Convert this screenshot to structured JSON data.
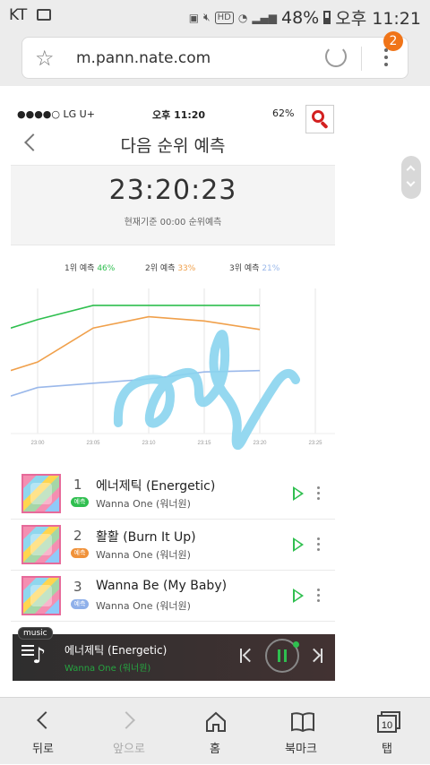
{
  "statusbar": {
    "carrier": "KT",
    "battery": "48%",
    "time": "오후 11:21",
    "hd": "HD"
  },
  "browser": {
    "url": "m.pann.nate.com",
    "tab_badge": "2"
  },
  "embedded": {
    "status": {
      "carrier": "●●●●○ LG U+",
      "time": "오후 11:20",
      "battery": "62%"
    },
    "title": "다음 순위 예측",
    "countdown": "23:20:23",
    "countdown_sub": "현재기준 00:00 순위예측",
    "legend": [
      {
        "label": "1위 예측",
        "pct": "46%",
        "color": "#2fbf4f"
      },
      {
        "label": "2위 예측",
        "pct": "33%",
        "color": "#f0a04b"
      },
      {
        "label": "3위 예측",
        "pct": "21%",
        "color": "#9ab8ea"
      }
    ],
    "chart_data": {
      "type": "line",
      "x": [
        "23:00",
        "23:05",
        "23:10",
        "23:15",
        "23:20",
        "23:25"
      ],
      "series": [
        {
          "values": [
            78,
            88,
            88,
            88,
            88,
            null
          ],
          "color": "#2fbf4f"
        },
        {
          "values": [
            48,
            72,
            80,
            77,
            71,
            null
          ],
          "color": "#f0a04b"
        },
        {
          "values": [
            30,
            33,
            36,
            41,
            42,
            null
          ],
          "color": "#9ab8ea"
        }
      ],
      "ylim": [
        0,
        100
      ],
      "grid": "vertical",
      "legend": "top"
    },
    "songs": [
      {
        "rank": "1",
        "title": "에너제틱 (Energetic)",
        "artist": "Wanna One (워너원)",
        "tag": "예측",
        "tag_color": "#2fbf4f"
      },
      {
        "rank": "2",
        "title": "활활 (Burn It Up)",
        "artist": "Wanna One (워너원)",
        "tag": "예측",
        "tag_color": "#f0923a"
      },
      {
        "rank": "3",
        "title": "Wanna Be (My Baby)",
        "artist": "Wanna One (워너원)",
        "tag": "예측",
        "tag_color": "#8fb0ea"
      }
    ],
    "player": {
      "tag": "music",
      "title": "에너제틱 (Energetic)",
      "artist": "Wanna One (워너원)"
    }
  },
  "bottomnav": [
    {
      "label": "뒤로",
      "icon": "back-icon"
    },
    {
      "label": "앞으로",
      "icon": "forward-icon"
    },
    {
      "label": "홈",
      "icon": "home-icon"
    },
    {
      "label": "북마크",
      "icon": "bookmark-icon"
    },
    {
      "label": "탭",
      "icon": "tabs-icon",
      "count": "10"
    }
  ]
}
